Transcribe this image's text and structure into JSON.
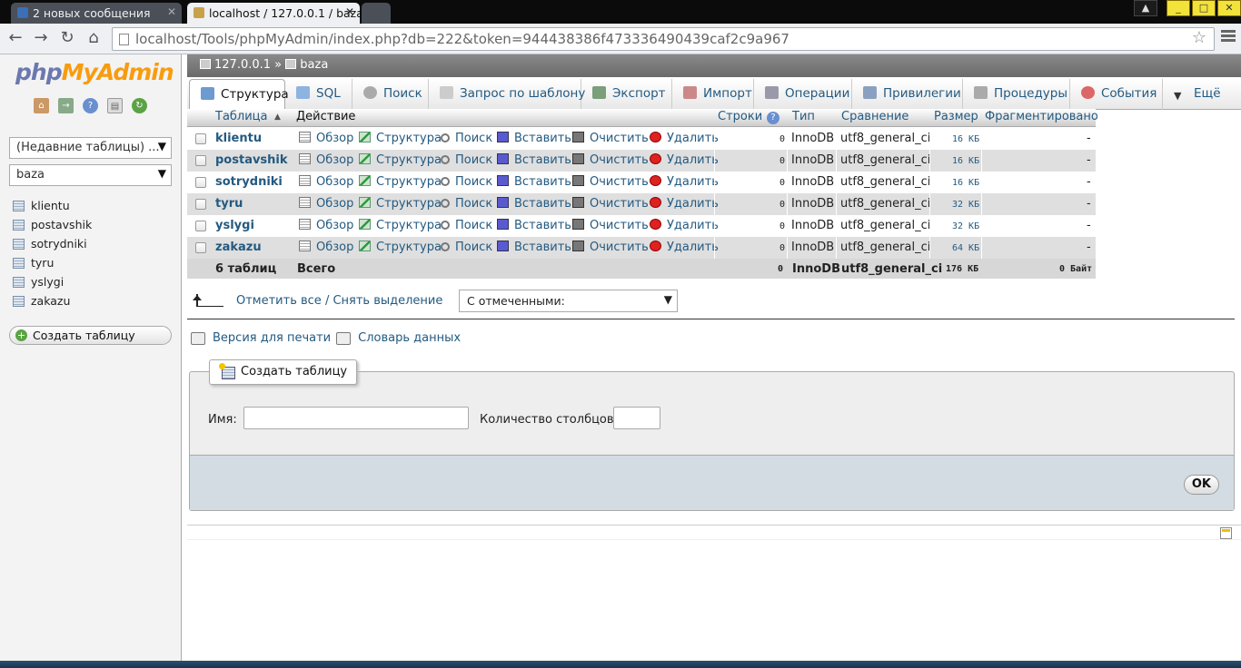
{
  "browser": {
    "tabs": [
      {
        "title": "2 новых сообщения"
      },
      {
        "title": "localhost / 127.0.0.1 / baza"
      }
    ],
    "url": "localhost/Tools/phpMyAdmin/index.php?db=222&token=944438386f473336490439caf2c9a967"
  },
  "sidebar": {
    "logo_php": "php",
    "logo_myadmin": "MyAdmin",
    "recent_tables": "(Недавние таблицы) ...",
    "db_select": "baza",
    "tables": [
      "klientu",
      "postavshik",
      "sotrydniki",
      "tyru",
      "yslygi",
      "zakazu"
    ],
    "create_table": "Создать таблицу"
  },
  "breadcrumb": {
    "server": "127.0.0.1",
    "sep": "»",
    "db": "baza"
  },
  "tabs": [
    {
      "label": "Структура",
      "icon": "structure-icon"
    },
    {
      "label": "SQL",
      "icon": "sql-icon"
    },
    {
      "label": "Поиск",
      "icon": "search-icon"
    },
    {
      "label": "Запрос по шаблону",
      "icon": "query-icon"
    },
    {
      "label": "Экспорт",
      "icon": "export-icon"
    },
    {
      "label": "Импорт",
      "icon": "import-icon"
    },
    {
      "label": "Операции",
      "icon": "wrench-icon"
    },
    {
      "label": "Привилегии",
      "icon": "privileges-icon"
    },
    {
      "label": "Процедуры",
      "icon": "routines-icon"
    },
    {
      "label": "События",
      "icon": "clock-icon"
    },
    {
      "label": "Ещё",
      "icon": "chevron-down-icon"
    }
  ],
  "table": {
    "headers": {
      "table": "Таблица",
      "action": "Действие",
      "rows": "Строки",
      "type": "Тип",
      "collation": "Сравнение",
      "size": "Размер",
      "overhead": "Фрагментировано"
    },
    "actions": {
      "browse": "Обзор",
      "structure": "Структура",
      "search": "Поиск",
      "insert": "Вставить",
      "empty": "Очистить",
      "drop": "Удалить"
    },
    "rows": [
      {
        "name": "klientu",
        "rows": "0",
        "type": "InnoDB",
        "collation": "utf8_general_ci",
        "size": "16 КБ",
        "overhead": "-"
      },
      {
        "name": "postavshik",
        "rows": "0",
        "type": "InnoDB",
        "collation": "utf8_general_ci",
        "size": "16 КБ",
        "overhead": "-"
      },
      {
        "name": "sotrydniki",
        "rows": "0",
        "type": "InnoDB",
        "collation": "utf8_general_ci",
        "size": "16 КБ",
        "overhead": "-"
      },
      {
        "name": "tyru",
        "rows": "0",
        "type": "InnoDB",
        "collation": "utf8_general_ci",
        "size": "32 КБ",
        "overhead": "-"
      },
      {
        "name": "yslygi",
        "rows": "0",
        "type": "InnoDB",
        "collation": "utf8_general_ci",
        "size": "32 КБ",
        "overhead": "-"
      },
      {
        "name": "zakazu",
        "rows": "0",
        "type": "InnoDB",
        "collation": "utf8_general_ci",
        "size": "64 КБ",
        "overhead": "-"
      }
    ],
    "summary": {
      "count": "6 таблиц",
      "label": "Всего",
      "rows": "0",
      "type": "InnoDB",
      "collation": "utf8_general_ci",
      "size": "176 КБ",
      "overhead": "0 Байт"
    }
  },
  "bulk": {
    "check_all": "Отметить все / Снять выделение",
    "with_selected": "С отмеченными:"
  },
  "links": {
    "print": "Версия для печати",
    "dictionary": "Словарь данных"
  },
  "create_form": {
    "legend": "Создать таблицу",
    "name_label": "Имя:",
    "cols_label": "Количество столбцов:",
    "ok": "OK"
  },
  "colors": {
    "link": "#235a81",
    "logo_php": "#6c78af",
    "logo_myadmin": "#f89c0e",
    "footer_bg": "#d3dce3"
  }
}
